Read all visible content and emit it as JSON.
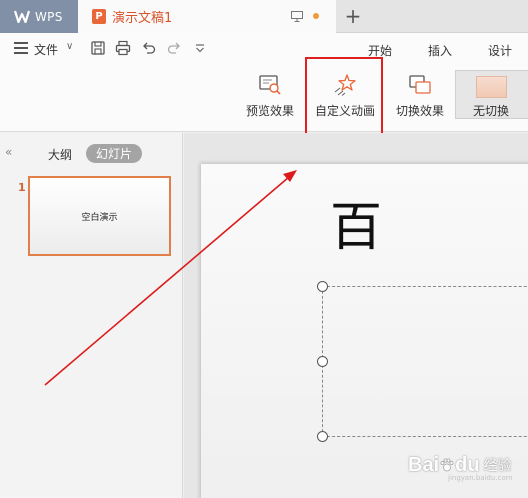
{
  "titlebar": {
    "app_tab_label": "WPS",
    "doc_tab_label": "演示文稿1",
    "new_tab_label": "+"
  },
  "menubar": {
    "file_label": "文件",
    "tabs": [
      {
        "label": "开始"
      },
      {
        "label": "插入"
      },
      {
        "label": "设计"
      }
    ]
  },
  "ribbon": {
    "preview_effect": "预览效果",
    "custom_animation": "自定义动画",
    "transition_effect": "切换效果",
    "no_transition": "无切换"
  },
  "left_panel": {
    "tab_outline": "大纲",
    "tab_slides": "幻灯片",
    "slides": [
      {
        "number": "1",
        "title": "空白演示"
      }
    ]
  },
  "canvas": {
    "partial_glyph": "百"
  },
  "watermark": {
    "brand_latin": "Bai",
    "brand_suffix": "du",
    "brand_cn": "经验",
    "url": "jingyan.baidu.com"
  },
  "colors": {
    "accent_orange": "#d9542b",
    "wps_tab_bg": "#8190a6",
    "highlight_red": "#e02020",
    "arrow_red": "#dd1a1a"
  }
}
